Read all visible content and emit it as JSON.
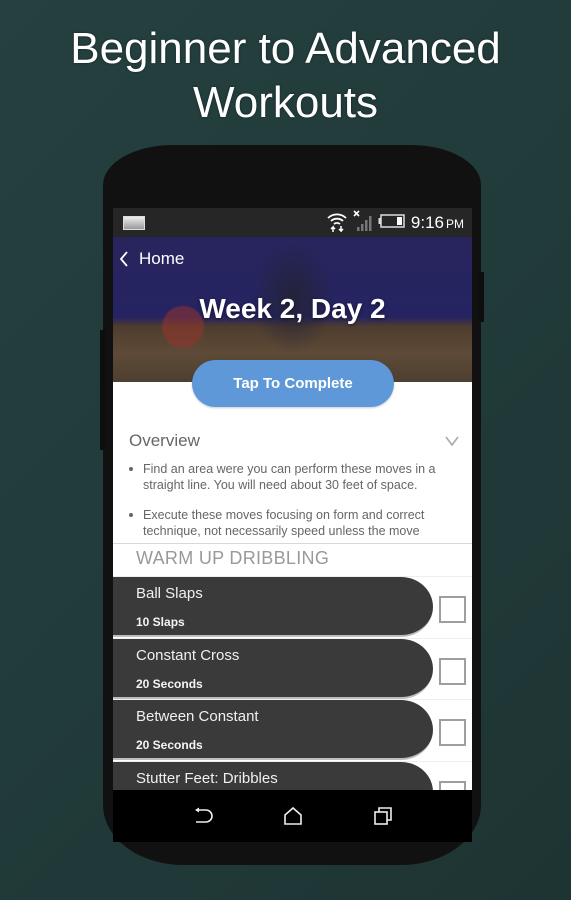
{
  "promo": {
    "headline_line1": "Beginner to Advanced",
    "headline_line2": "Workouts"
  },
  "status_bar": {
    "notification_icon": "image-thumbnail-icon",
    "wifi_icon": "wifi-icon",
    "signal_icon": "no-signal-icon",
    "battery_icon": "battery-icon",
    "time": "9:16",
    "ampm": "PM"
  },
  "header": {
    "back_label": "Home",
    "title": "Week 2, Day 2",
    "complete_button": "Tap To Complete"
  },
  "overview": {
    "title": "Overview",
    "expand_icon": "chevron-down-icon",
    "bullets": [
      "Find an area were you can perform these moves in a straight line. You will need about 30 feet of space.",
      "Execute these moves focusing on form and correct technique, not necessarily speed unless the move"
    ]
  },
  "section": {
    "title": "WARM UP DRIBBLING"
  },
  "exercises": [
    {
      "name": "Ball Slaps",
      "detail": "10 Slaps",
      "checked": false
    },
    {
      "name": "Constant Cross",
      "detail": "20 Seconds",
      "checked": false
    },
    {
      "name": "Between Constant",
      "detail": "20 Seconds",
      "checked": false
    },
    {
      "name": "Stutter Feet: Dribbles",
      "detail": "",
      "checked": false
    }
  ],
  "nav_bar": {
    "back": "back-icon",
    "home": "home-icon",
    "recents": "recent-apps-icon"
  },
  "colors": {
    "background": "#223c3b",
    "button_blue": "#5e98d8",
    "exercise_pill": "#3a3a3a"
  }
}
